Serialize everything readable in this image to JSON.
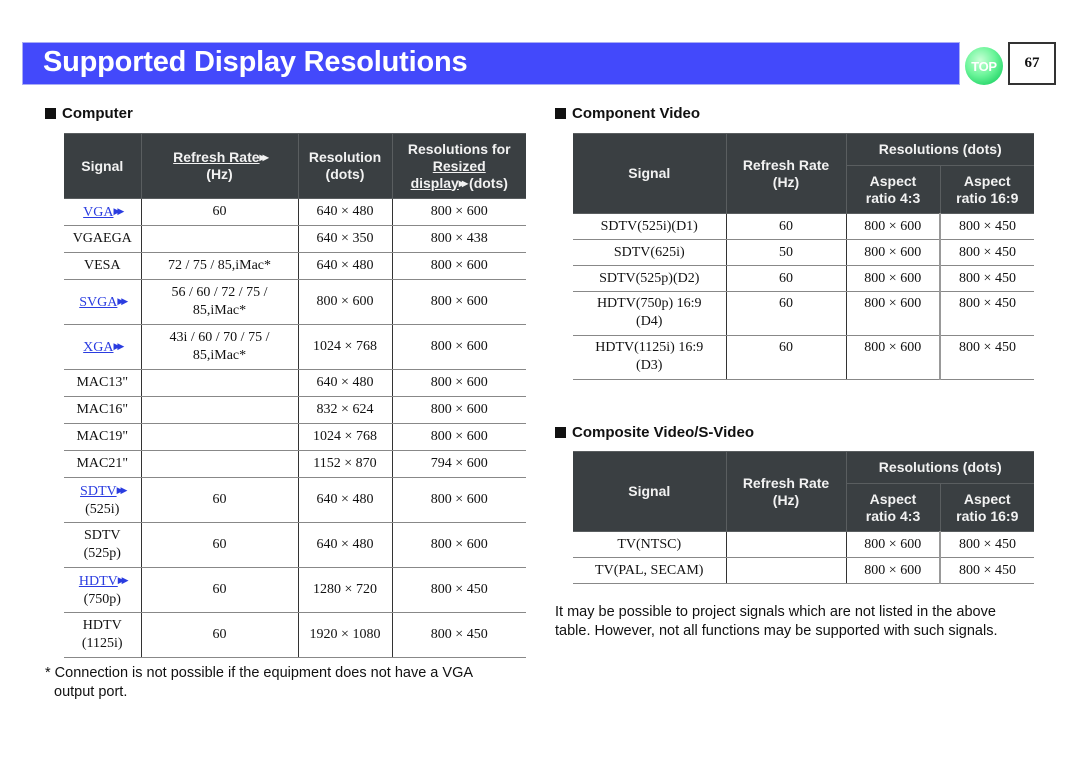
{
  "header": {
    "title": "Supported Display Resolutions",
    "top_button": "TOP",
    "page_number": "67",
    "title_bar_color": "#4349fb"
  },
  "computer": {
    "heading": "Computer",
    "headers": {
      "signal": "Signal",
      "refresh_rate": "Refresh Rate",
      "refresh_unit": "(Hz)",
      "resolution": "Resolution",
      "resolution_unit": "(dots)",
      "resized_line1": "Resolutions for",
      "resized_line2": "Resized",
      "resized_line3": "display",
      "resized_unit": "(dots)"
    },
    "rows": [
      {
        "signal": "VGA",
        "sub": "",
        "link": true,
        "refresh": "60",
        "resolution": "640 × 480",
        "resized": "800 × 600"
      },
      {
        "signal": "VGAEGA",
        "sub": "",
        "link": false,
        "refresh": "",
        "resolution": "640 × 350",
        "resized": "800 × 438"
      },
      {
        "signal": "VESA",
        "sub": "",
        "link": false,
        "refresh": "72 / 75 / 85,iMac*",
        "resolution": "640 × 480",
        "resized": "800 × 600"
      },
      {
        "signal": "SVGA",
        "sub": "",
        "link": true,
        "refresh": "56 / 60 / 72 / 75 /",
        "refresh2": "85,iMac*",
        "resolution": "800 × 600",
        "resized": "800 × 600"
      },
      {
        "signal": "XGA",
        "sub": "",
        "link": true,
        "refresh": "43i / 60 / 70 / 75 /",
        "refresh2": "85,iMac*",
        "resolution": "1024 × 768",
        "resized": "800 × 600"
      },
      {
        "signal": "MAC13\"",
        "sub": "",
        "link": false,
        "refresh": "",
        "resolution": "640 × 480",
        "resized": "800 × 600"
      },
      {
        "signal": "MAC16\"",
        "sub": "",
        "link": false,
        "refresh": "",
        "resolution": "832 × 624",
        "resized": "800 × 600"
      },
      {
        "signal": "MAC19\"",
        "sub": "",
        "link": false,
        "refresh": "",
        "resolution": "1024 × 768",
        "resized": "800 × 600"
      },
      {
        "signal": "MAC21\"",
        "sub": "",
        "link": false,
        "refresh": "",
        "resolution": "1152 × 870",
        "resized": "794 × 600"
      },
      {
        "signal": "SDTV",
        "sub": "(525i)",
        "link": true,
        "refresh": "60",
        "resolution": "640 × 480",
        "resized": "800 × 600"
      },
      {
        "signal": "SDTV",
        "sub": "(525p)",
        "link": false,
        "refresh": "60",
        "resolution": "640 × 480",
        "resized": "800 × 600"
      },
      {
        "signal": "HDTV",
        "sub": "(750p)",
        "link": true,
        "refresh": "60",
        "resolution": "1280 × 720",
        "resized": "800 × 450"
      },
      {
        "signal": "HDTV",
        "sub": "(1125i)",
        "link": false,
        "refresh": "60",
        "resolution": "1920 × 1080",
        "resized": "800 × 450"
      }
    ],
    "footnote_line1": "* Connection is not possible if the equipment does not have a VGA",
    "footnote_line2": "output port."
  },
  "component": {
    "heading": "Component Video",
    "headers": {
      "signal": "Signal",
      "refresh_rate": "Refresh Rate",
      "refresh_unit": "(Hz)",
      "resolutions": "Resolutions (dots)",
      "aspect43_line1": "Aspect",
      "aspect43_line2": "ratio 4:3",
      "aspect169_line1": "Aspect",
      "aspect169_line2": "ratio 16:9"
    },
    "rows": [
      {
        "signal": "SDTV(525i)(D1)",
        "sub": "",
        "refresh": "60",
        "r43": "800 × 600",
        "r169": "800 × 450"
      },
      {
        "signal": "SDTV(625i)",
        "sub": "",
        "refresh": "50",
        "r43": "800 × 600",
        "r169": "800 × 450"
      },
      {
        "signal": "SDTV(525p)(D2)",
        "sub": "",
        "refresh": "60",
        "r43": "800 × 600",
        "r169": "800 × 450"
      },
      {
        "signal": "HDTV(750p) 16:9",
        "sub": "(D4)",
        "refresh": "60",
        "r43": "800 × 600",
        "r169": "800 × 450"
      },
      {
        "signal": "HDTV(1125i) 16:9",
        "sub": "(D3)",
        "refresh": "60",
        "r43": "800 × 600",
        "r169": "800 × 450"
      }
    ]
  },
  "composite": {
    "heading": "Composite Video/S-Video",
    "headers": {
      "signal": "Signal",
      "refresh_rate": "Refresh Rate",
      "refresh_unit": "(Hz)",
      "resolutions": "Resolutions (dots)",
      "aspect43_line1": "Aspect",
      "aspect43_line2": "ratio 4:3",
      "aspect169_line1": "Aspect",
      "aspect169_line2": "ratio 16:9"
    },
    "rows": [
      {
        "signal": "TV(NTSC)",
        "refresh": "",
        "r43": "800 × 600",
        "r169": "800 × 450"
      },
      {
        "signal": "TV(PAL, SECAM)",
        "refresh": "",
        "r43": "800 × 600",
        "r169": "800 × 450"
      }
    ],
    "note_line1": "It may be possible to project signals which are not listed in the above",
    "note_line2": "table. However, not all functions may be supported with such signals."
  }
}
